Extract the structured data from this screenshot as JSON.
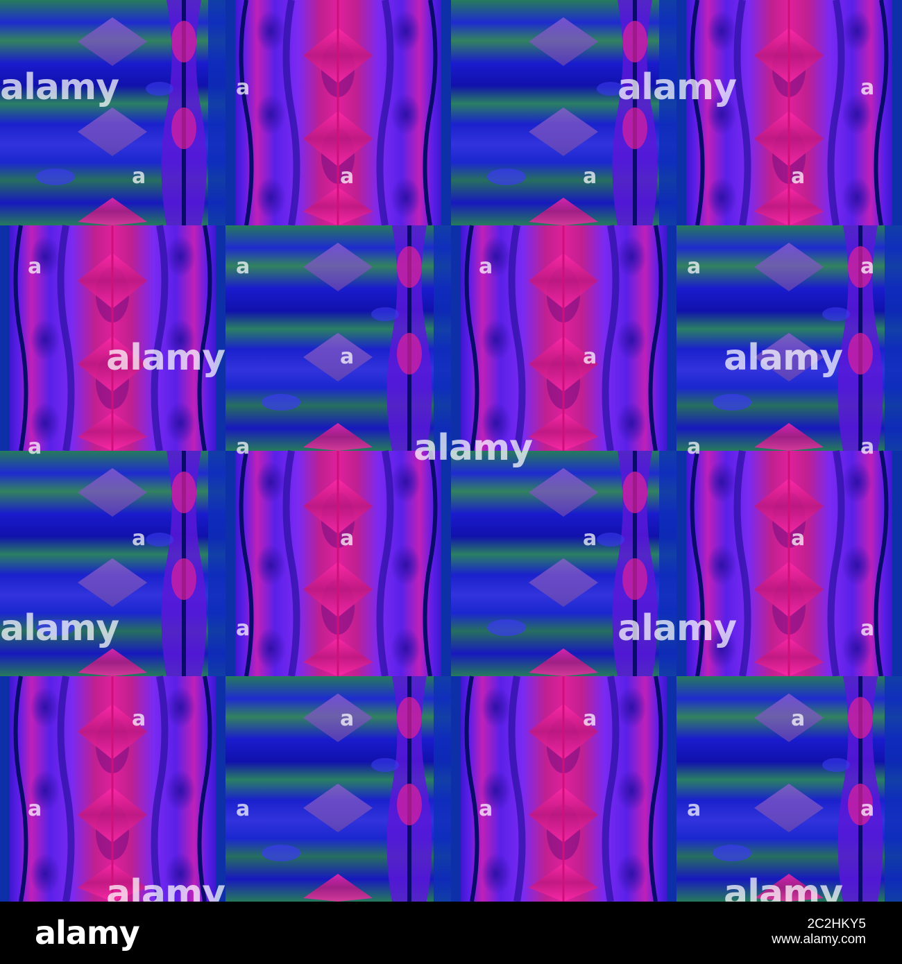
{
  "watermark": {
    "text": "alamy",
    "small": "a"
  },
  "footer": {
    "logo": "alamy",
    "image_id": "2C2HKY5",
    "site": "www.alamy.com"
  },
  "colors": {
    "base_blue": "#2010c8",
    "violet": "#7a22f0",
    "magenta": "#e0209a",
    "dark_navy": "#0a0a6a",
    "green": "#2aa030",
    "footer_bg": "#000000"
  }
}
